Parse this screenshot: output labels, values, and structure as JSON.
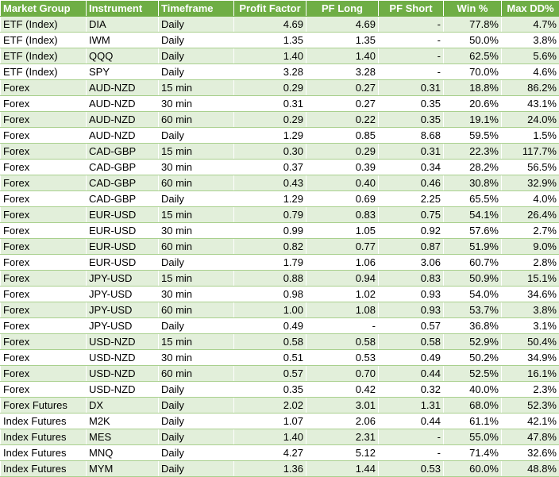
{
  "colors": {
    "header_bg": "#6fae45",
    "header_text": "#ffffff",
    "band": "#e2efda",
    "border": "#a9d08e"
  },
  "columns": [
    "Market Group",
    "Instrument",
    "Timeframe",
    "Profit Factor",
    "PF Long",
    "PF Short",
    "Win %",
    "Max DD%"
  ],
  "rows": [
    [
      "ETF (Index)",
      "DIA",
      "Daily",
      "4.69",
      "4.69",
      "-",
      "77.8%",
      "4.7%"
    ],
    [
      "ETF (Index)",
      "IWM",
      "Daily",
      "1.35",
      "1.35",
      "-",
      "50.0%",
      "3.8%"
    ],
    [
      "ETF (Index)",
      "QQQ",
      "Daily",
      "1.40",
      "1.40",
      "-",
      "62.5%",
      "5.6%"
    ],
    [
      "ETF (Index)",
      "SPY",
      "Daily",
      "3.28",
      "3.28",
      "-",
      "70.0%",
      "4.6%"
    ],
    [
      "Forex",
      "AUD-NZD",
      "15 min",
      "0.29",
      "0.27",
      "0.31",
      "18.8%",
      "86.2%"
    ],
    [
      "Forex",
      "AUD-NZD",
      "30 min",
      "0.31",
      "0.27",
      "0.35",
      "20.6%",
      "43.1%"
    ],
    [
      "Forex",
      "AUD-NZD",
      "60 min",
      "0.29",
      "0.22",
      "0.35",
      "19.1%",
      "24.0%"
    ],
    [
      "Forex",
      "AUD-NZD",
      "Daily",
      "1.29",
      "0.85",
      "8.68",
      "59.5%",
      "1.5%"
    ],
    [
      "Forex",
      "CAD-GBP",
      "15 min",
      "0.30",
      "0.29",
      "0.31",
      "22.3%",
      "117.7%"
    ],
    [
      "Forex",
      "CAD-GBP",
      "30 min",
      "0.37",
      "0.39",
      "0.34",
      "28.2%",
      "56.5%"
    ],
    [
      "Forex",
      "CAD-GBP",
      "60 min",
      "0.43",
      "0.40",
      "0.46",
      "30.8%",
      "32.9%"
    ],
    [
      "Forex",
      "CAD-GBP",
      "Daily",
      "1.29",
      "0.69",
      "2.25",
      "65.5%",
      "4.0%"
    ],
    [
      "Forex",
      "EUR-USD",
      "15 min",
      "0.79",
      "0.83",
      "0.75",
      "54.1%",
      "26.4%"
    ],
    [
      "Forex",
      "EUR-USD",
      "30 min",
      "0.99",
      "1.05",
      "0.92",
      "57.6%",
      "2.7%"
    ],
    [
      "Forex",
      "EUR-USD",
      "60 min",
      "0.82",
      "0.77",
      "0.87",
      "51.9%",
      "9.0%"
    ],
    [
      "Forex",
      "EUR-USD",
      "Daily",
      "1.79",
      "1.06",
      "3.06",
      "60.7%",
      "2.8%"
    ],
    [
      "Forex",
      "JPY-USD",
      "15 min",
      "0.88",
      "0.94",
      "0.83",
      "50.9%",
      "15.1%"
    ],
    [
      "Forex",
      "JPY-USD",
      "30 min",
      "0.98",
      "1.02",
      "0.93",
      "54.0%",
      "34.6%"
    ],
    [
      "Forex",
      "JPY-USD",
      "60 min",
      "1.00",
      "1.08",
      "0.93",
      "53.7%",
      "3.8%"
    ],
    [
      "Forex",
      "JPY-USD",
      "Daily",
      "0.49",
      "-",
      "0.57",
      "36.8%",
      "3.1%"
    ],
    [
      "Forex",
      "USD-NZD",
      "15 min",
      "0.58",
      "0.58",
      "0.58",
      "52.9%",
      "50.4%"
    ],
    [
      "Forex",
      "USD-NZD",
      "30 min",
      "0.51",
      "0.53",
      "0.49",
      "50.2%",
      "34.9%"
    ],
    [
      "Forex",
      "USD-NZD",
      "60 min",
      "0.57",
      "0.70",
      "0.44",
      "52.5%",
      "16.1%"
    ],
    [
      "Forex",
      "USD-NZD",
      "Daily",
      "0.35",
      "0.42",
      "0.32",
      "40.0%",
      "2.3%"
    ],
    [
      "Forex Futures",
      "DX",
      "Daily",
      "2.02",
      "3.01",
      "1.31",
      "68.0%",
      "52.3%"
    ],
    [
      "Index Futures",
      "M2K",
      "Daily",
      "1.07",
      "2.06",
      "0.44",
      "61.1%",
      "42.1%"
    ],
    [
      "Index Futures",
      "MES",
      "Daily",
      "1.40",
      "2.31",
      "-",
      "55.0%",
      "47.8%"
    ],
    [
      "Index Futures",
      "MNQ",
      "Daily",
      "4.27",
      "5.12",
      "-",
      "71.4%",
      "32.6%"
    ],
    [
      "Index Futures",
      "MYM",
      "Daily",
      "1.36",
      "1.44",
      "0.53",
      "60.0%",
      "48.8%"
    ]
  ]
}
